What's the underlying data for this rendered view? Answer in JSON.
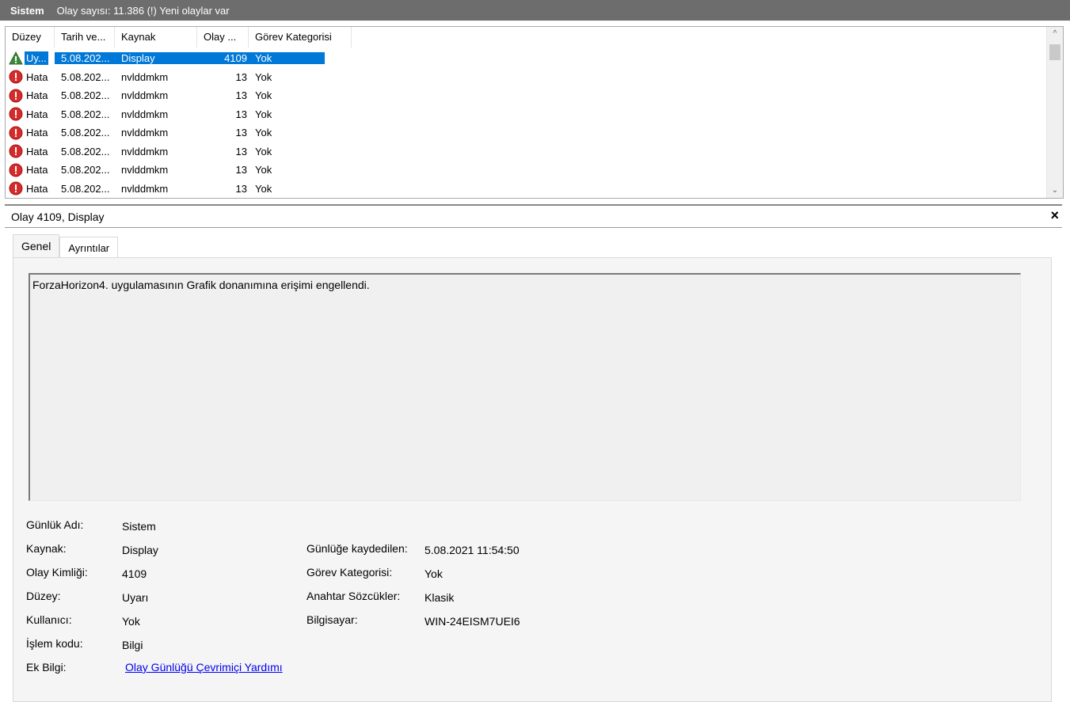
{
  "titlebar": {
    "title": "Sistem",
    "count_text": "Olay sayısı: 11.386 (!) Yeni olaylar var",
    "background": "#6d6d6d"
  },
  "event_list": {
    "columns": [
      "Düzey",
      "Tarih ve...",
      "Kaynak",
      "Olay ...",
      "Görev Kategorisi"
    ],
    "rows": [
      {
        "icon": "warning-icon",
        "level": "Uy...",
        "date": "5.08.202...",
        "source": "Display",
        "id": "4109",
        "category": "Yok",
        "selected": true
      },
      {
        "icon": "error-icon",
        "level": "Hata",
        "date": "5.08.202...",
        "source": "nvlddmkm",
        "id": "13",
        "category": "Yok",
        "selected": false
      },
      {
        "icon": "error-icon",
        "level": "Hata",
        "date": "5.08.202...",
        "source": "nvlddmkm",
        "id": "13",
        "category": "Yok",
        "selected": false
      },
      {
        "icon": "error-icon",
        "level": "Hata",
        "date": "5.08.202...",
        "source": "nvlddmkm",
        "id": "13",
        "category": "Yok",
        "selected": false
      },
      {
        "icon": "error-icon",
        "level": "Hata",
        "date": "5.08.202...",
        "source": "nvlddmkm",
        "id": "13",
        "category": "Yok",
        "selected": false
      },
      {
        "icon": "error-icon",
        "level": "Hata",
        "date": "5.08.202...",
        "source": "nvlddmkm",
        "id": "13",
        "category": "Yok",
        "selected": false
      },
      {
        "icon": "error-icon",
        "level": "Hata",
        "date": "5.08.202...",
        "source": "nvlddmkm",
        "id": "13",
        "category": "Yok",
        "selected": false
      },
      {
        "icon": "error-icon",
        "level": "Hata",
        "date": "5.08.202...",
        "source": "nvlddmkm",
        "id": "13",
        "category": "Yok",
        "selected": false
      }
    ],
    "selection_color": "#0078d7"
  },
  "detail": {
    "title": "Olay 4109, Display",
    "close_glyph": "×",
    "tabs": [
      "Genel",
      "Ayrıntılar"
    ],
    "message": "ForzaHorizon4. uygulamasının Grafik donanımına erişimi engellendi.",
    "props": {
      "log_name_label": "Günlük Adı:",
      "log_name": "Sistem",
      "source_label": "Kaynak:",
      "source": "Display",
      "event_id_label": "Olay Kimliği:",
      "event_id": "4109",
      "level_label": "Düzey:",
      "level": "Uyarı",
      "user_label": "Kullanıcı:",
      "user": "Yok",
      "opcode_label": "İşlem kodu:",
      "opcode": "Bilgi",
      "more_info_label": "Ek Bilgi:",
      "more_info_link": "Olay Günlüğü Çevrimiçi Yardımı",
      "logged_label": "Günlüğe kaydedilen:",
      "logged": "5.08.2021 11:54:50",
      "task_category_label": "Görev Kategorisi:",
      "task_category": "Yok",
      "keywords_label": "Anahtar Sözcükler:",
      "keywords": "Klasik",
      "computer_label": "Bilgisayar:",
      "computer": "WIN-24EISM7UEI6"
    }
  }
}
